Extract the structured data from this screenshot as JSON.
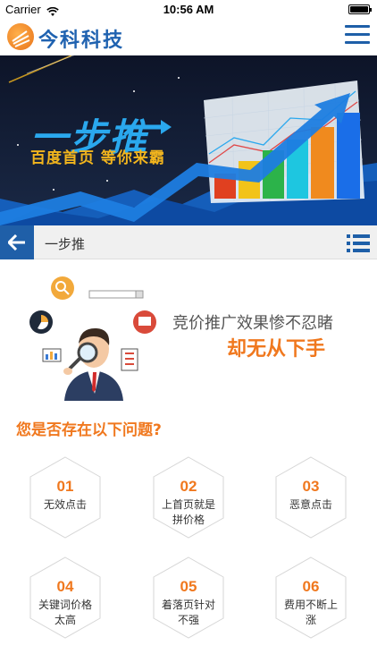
{
  "status_bar": {
    "carrier": "Carrier",
    "time": "10:56 AM"
  },
  "header": {
    "brand": "今科科技"
  },
  "banner": {
    "title": "一步推",
    "subtitle": "百度首页  等你来霸"
  },
  "sub_nav": {
    "title": "一步推"
  },
  "promo": {
    "line1": "竞价推广效果惨不忍睹",
    "line2": "却无从下手"
  },
  "questions": {
    "title": "您是否存在以下问题?",
    "items": [
      {
        "num": "01",
        "text": "无效点击"
      },
      {
        "num": "02",
        "text": "上首页就是拼价格"
      },
      {
        "num": "03",
        "text": "恶意点击"
      },
      {
        "num": "04",
        "text": "关键词价格太高"
      },
      {
        "num": "05",
        "text": "着落页针对不强"
      },
      {
        "num": "06",
        "text": "费用不断上涨"
      }
    ]
  },
  "colors": {
    "brand_blue": "#1f5fa8",
    "accent_orange": "#f0781e",
    "banner_bg": "#0d1428"
  }
}
